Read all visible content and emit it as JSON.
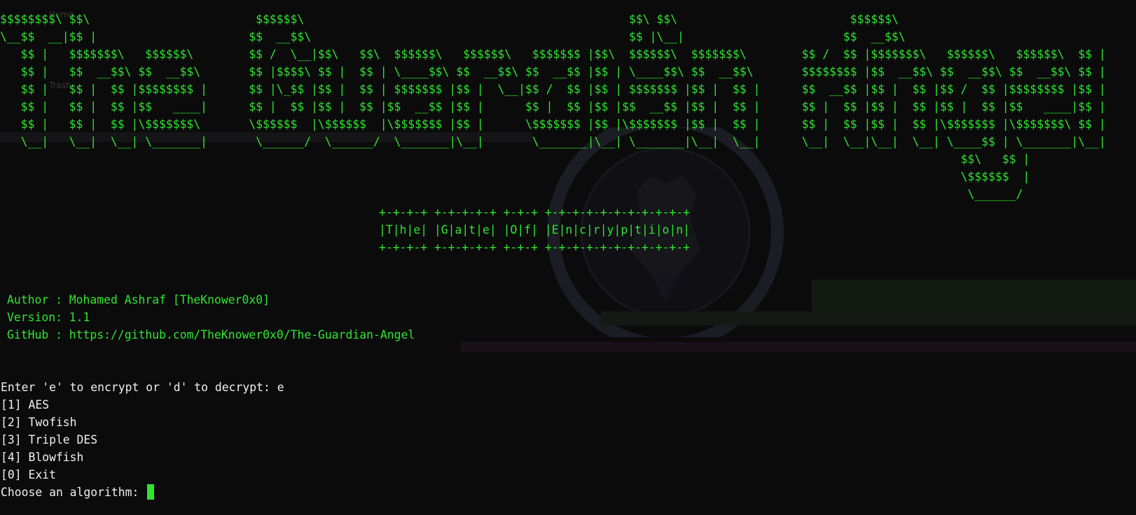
{
  "terminal": {
    "desktop_labels": [
      "Home",
      "Trash"
    ],
    "banner_ascii": "$$$$$$$$\\ $$\\                        $$$$$$\\                                               $$\\ $$\\                         $$$$$$\\                                                $$\\ \n\\__$$  __|$$ |                      $$  __$$\\                                              $$ |\\__|                       $$  __$$\\                                               $$ |\n   $$ |   $$$$$$$\\   $$$$$$\\        $$ /  \\__|$$\\   $$\\  $$$$$$\\   $$$$$$\\   $$$$$$$ |$$\\  $$$$$$\\  $$$$$$$\\        $$ /  $$ |$$$$$$$\\   $$$$$$\\   $$$$$$\\  $$ |\n   $$ |   $$  __$$\\ $$  __$$\\       $$ |$$$$\\ $$ |  $$ | \\____$$\\ $$  __$$\\ $$  __$$ |$$ | \\____$$\\ $$  __$$\\       $$$$$$$$ |$$  __$$\\ $$  __$$\\ $$  __$$\\ $$ |\n   $$ |   $$ |  $$ |$$$$$$$$ |      $$ |\\_$$ |$$ |  $$ | $$$$$$$ |$$ |  \\__|$$ /  $$ |$$ | $$$$$$$ |$$ |  $$ |      $$  __$$ |$$ |  $$ |$$ /  $$ |$$$$$$$$ |$$ |\n   $$ |   $$ |  $$ |$$   ____|      $$ |  $$ |$$ |  $$ |$$  __$$ |$$ |      $$ |  $$ |$$ |$$  __$$ |$$ |  $$ |      $$ |  $$ |$$ |  $$ |$$ |  $$ |$$   ____|$$ |\n   $$ |   $$ |  $$ |\\$$$$$$$\\       \\$$$$$$  |\\$$$$$$  |\\$$$$$$$ |$$ |      \\$$$$$$$ |$$ |\\$$$$$$$ |$$ |  $$ |      $$ |  $$ |$$ |  $$ |\\$$$$$$$ |\\$$$$$$$\\ $$ |\n   \\__|   \\__|  \\__| \\_______|       \\______/  \\______/  \\_______|\\__|       \\_______|\\__| \\_______|\\__|  \\__|      \\__|  \\__|\\__|  \\__| \\____$$ | \\_______|\\__|\n                                                                                                                                           $$\\   $$ |\n                                                                                                                                           \\$$$$$$  |\n                                                                                                                                            \\______/ ",
    "subtitle_ascii": "+-+-+-+ +-+-+-+-+ +-+-+ +-+-+-+-+-+-+-+-+-+-+\n|T|h|e| |G|a|t|e| |O|f| |E|n|c|r|y|p|t|i|o|n|\n+-+-+-+ +-+-+-+-+ +-+-+ +-+-+-+-+-+-+-+-+-+-+",
    "info": {
      "author": "Author : Mohamed Ashraf [TheKnower0x0]",
      "version": "Version: 1.1",
      "github": "GitHub : https://github.com/TheKnower0x0/The-Guardian-Angel"
    },
    "prompt_mode": "Enter 'e' to encrypt or 'd' to decrypt: e",
    "menu": [
      "[1] AES",
      "[2] Twofish",
      "[3] Triple DES",
      "[4] Blowfish",
      "[0] Exit"
    ],
    "prompt_algorithm": "Choose an algorithm: ",
    "colors": {
      "background": "#0b0b0c",
      "accent_green": "#2ee62e",
      "default_text": "#f0f0f0"
    },
    "icons": [
      "cursor-block",
      "agency-seal-watermark"
    ]
  }
}
